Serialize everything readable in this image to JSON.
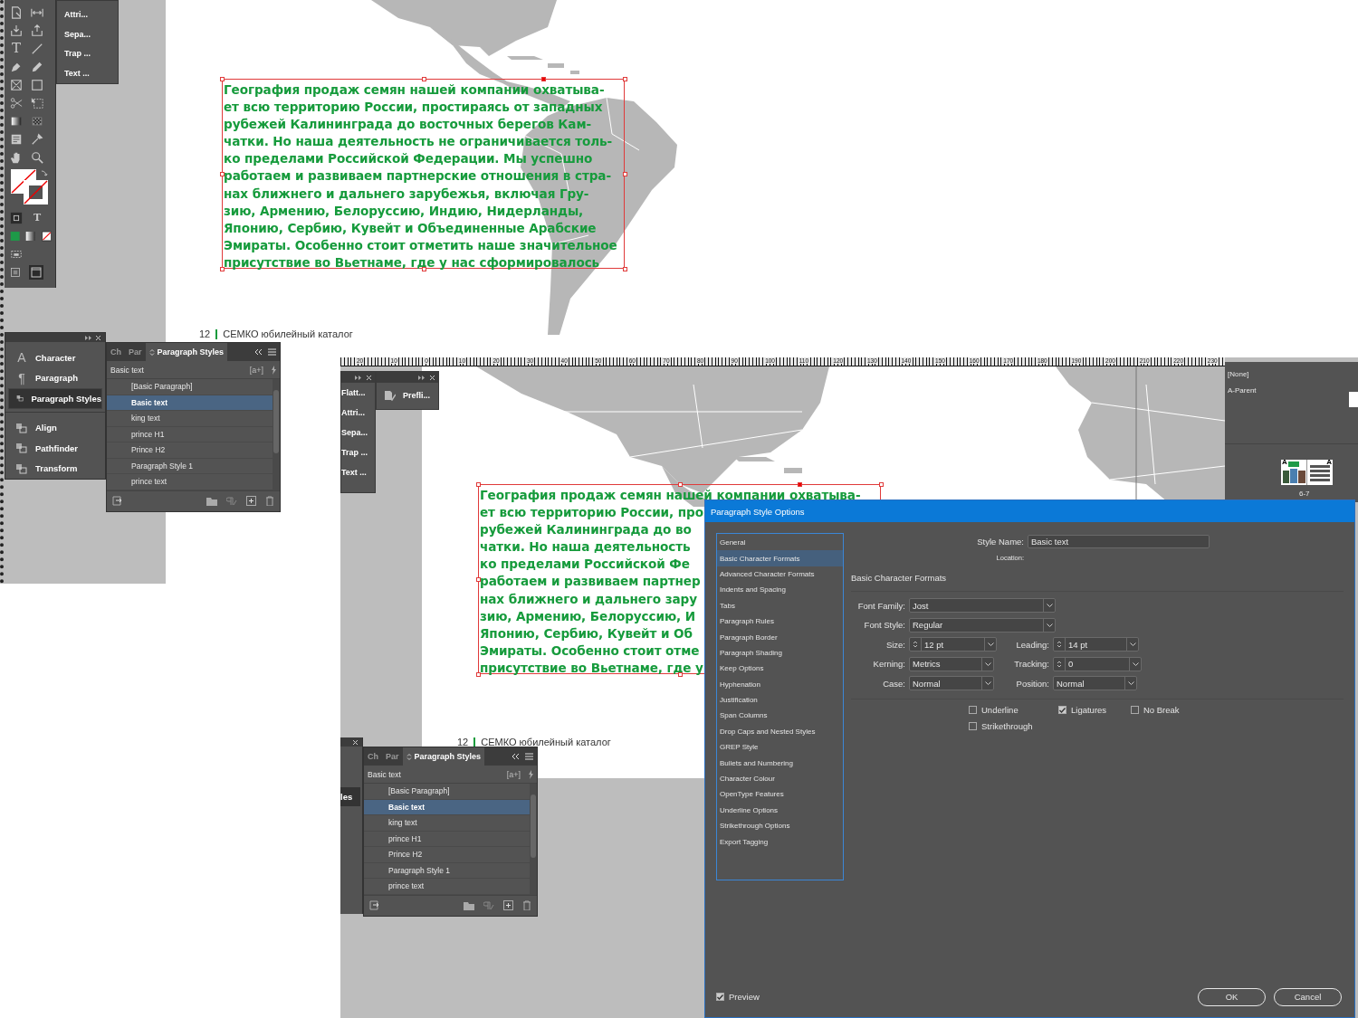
{
  "top_view": {
    "toolbar": {
      "type_tool": "T",
      "formatting_toggle": "T"
    },
    "flyout": [
      "Attri...",
      "Sepa...",
      "Trap ...",
      "Text ..."
    ],
    "text_frame": {
      "lines": [
        "География продаж семян нашей компании охватыва-",
        "ет всю территорию России, простираясь от западных",
        "рубежей Калининграда до восточных берегов Кам-",
        "чатки. Но наша деятельность не ограничивается толь-",
        "ко пределами Российской Федерации. Мы успешно",
        "работаем и развиваем партнерские отношения в стра-",
        "нах ближнего и дальнего зарубежья, включая Гру-",
        "зию, Армению, Белоруссию, Индию, Нидерланды,",
        "Японию, Сербию, Кувейт и Объединенные Арабские",
        "Эмираты. Особенно стоит отметить наше значительное",
        "присутствие во Вьетнаме, где у нас сформировалось"
      ]
    },
    "footer": {
      "page_number": "12",
      "title": "СЕМКО юбилейный каталог"
    },
    "dock": [
      [
        {
          "label": "Character",
          "glyph": "A",
          "selected": false
        },
        {
          "label": "Paragraph",
          "glyph": "¶",
          "selected": false
        },
        {
          "label": "Paragraph Styles",
          "selected": true
        }
      ],
      [
        {
          "label": "Align",
          "selected": false
        },
        {
          "label": "Pathfinder",
          "selected": false
        },
        {
          "label": "Transform",
          "selected": false
        }
      ]
    ],
    "styles_panel": {
      "tabs": [
        {
          "label": "Ch",
          "selected": false
        },
        {
          "label": "Par",
          "selected": false
        },
        {
          "label": "Paragraph Styles",
          "selected": true
        }
      ],
      "current": "Basic text",
      "new_button": "[a+]",
      "items": [
        {
          "label": "[Basic Paragraph]",
          "selected": false
        },
        {
          "label": "Basic text",
          "selected": true
        },
        {
          "label": "king text",
          "selected": false
        },
        {
          "label": "prince H1",
          "selected": false
        },
        {
          "label": "Prince H2",
          "selected": false
        },
        {
          "label": "Paragraph Style 1",
          "selected": false
        },
        {
          "label": "prince text",
          "selected": false
        }
      ]
    }
  },
  "bottom_view": {
    "ruler": [
      "20",
      "10",
      "0",
      "10",
      "20",
      "30",
      "40",
      "50",
      "60",
      "70",
      "80",
      "90",
      "100",
      "110",
      "120",
      "130",
      "140",
      "150",
      "160",
      "170",
      "180",
      "190",
      "200",
      "210",
      "220",
      "230"
    ],
    "flyouts": [
      [
        "Flatt...",
        "Attri...",
        "Sepa...",
        "Trap ...",
        "Text ..."
      ],
      [
        "Prefli..."
      ]
    ],
    "text_frame": {
      "lines": [
        "География продаж семян нашей компании охватыва-",
        "ет всю территорию России, про",
        "рубежей Калининграда до во",
        "чатки. Но наша деятельность",
        "ко пределами Российской Фе",
        "работаем и развиваем партнер",
        "нах ближнего и дальнего зару",
        "зию, Армению, Белоруссию, И",
        "Японию, Сербию, Кувейт и Об",
        "Эмираты. Особенно стоит отме",
        "присутствие во Вьетнаме, где у"
      ]
    },
    "footer": {
      "page_number": "12",
      "title": "СЕМКО юбилейный каталог"
    },
    "dock_fragment": {
      "label": "les",
      "selected": true
    },
    "styles_panel": {
      "tabs": [
        {
          "label": "Ch",
          "selected": false
        },
        {
          "label": "Par",
          "selected": false
        },
        {
          "label": "Paragraph Styles",
          "selected": true
        }
      ],
      "current": "Basic text",
      "new_button": "[a+]",
      "items": [
        {
          "label": "[Basic Paragraph]",
          "selected": false
        },
        {
          "label": "Basic text",
          "selected": true
        },
        {
          "label": "king text",
          "selected": false
        },
        {
          "label": "prince H1",
          "selected": false
        },
        {
          "label": "Prince H2",
          "selected": false
        },
        {
          "label": "Paragraph Style 1",
          "selected": false
        },
        {
          "label": "prince text",
          "selected": false
        }
      ]
    },
    "pages_panel": {
      "items": [
        "[None]",
        "A-Parent"
      ],
      "master_marks": [
        "A",
        "A"
      ],
      "spread": "6-7"
    },
    "dialog": {
      "title": "Paragraph Style Options",
      "sections": [
        {
          "label": "General",
          "selected": false
        },
        {
          "label": "Basic Character Formats",
          "selected": true
        },
        {
          "label": "Advanced Character Formats",
          "selected": false
        },
        {
          "label": "Indents and Spacing",
          "selected": false
        },
        {
          "label": "Tabs",
          "selected": false
        },
        {
          "label": "Paragraph Rules",
          "selected": false
        },
        {
          "label": "Paragraph Border",
          "selected": false
        },
        {
          "label": "Paragraph Shading",
          "selected": false
        },
        {
          "label": "Keep Options",
          "selected": false
        },
        {
          "label": "Hyphenation",
          "selected": false
        },
        {
          "label": "Justification",
          "selected": false
        },
        {
          "label": "Span Columns",
          "selected": false
        },
        {
          "label": "Drop Caps and Nested Styles",
          "selected": false
        },
        {
          "label": "GREP Style",
          "selected": false
        },
        {
          "label": "Bullets and Numbering",
          "selected": false
        },
        {
          "label": "Character Colour",
          "selected": false
        },
        {
          "label": "OpenType Features",
          "selected": false
        },
        {
          "label": "Underline Options",
          "selected": false
        },
        {
          "label": "Strikethrough Options",
          "selected": false
        },
        {
          "label": "Export Tagging",
          "selected": false
        }
      ],
      "style_name_label": "Style Name:",
      "style_name": "Basic text",
      "location_label": "Location:",
      "section_title": "Basic Character Formats",
      "font_family": {
        "label": "Font Family:",
        "value": "Jost"
      },
      "font_style": {
        "label": "Font Style:",
        "value": "Regular"
      },
      "size": {
        "label": "Size:",
        "value": "12 pt"
      },
      "leading": {
        "label": "Leading:",
        "value": "14 pt"
      },
      "kerning": {
        "label": "Kerning:",
        "value": "Metrics"
      },
      "tracking": {
        "label": "Tracking:",
        "value": "0"
      },
      "case": {
        "label": "Case:",
        "value": "Normal"
      },
      "position": {
        "label": "Position:",
        "value": "Normal"
      },
      "checkboxes": [
        {
          "label": "Underline",
          "checked": false
        },
        {
          "label": "Ligatures",
          "checked": true
        },
        {
          "label": "No Break",
          "checked": false
        },
        {
          "label": "Strikethrough",
          "checked": false
        }
      ],
      "preview": {
        "label": "Preview",
        "checked": true
      },
      "buttons": [
        "OK",
        "Cancel"
      ]
    }
  }
}
